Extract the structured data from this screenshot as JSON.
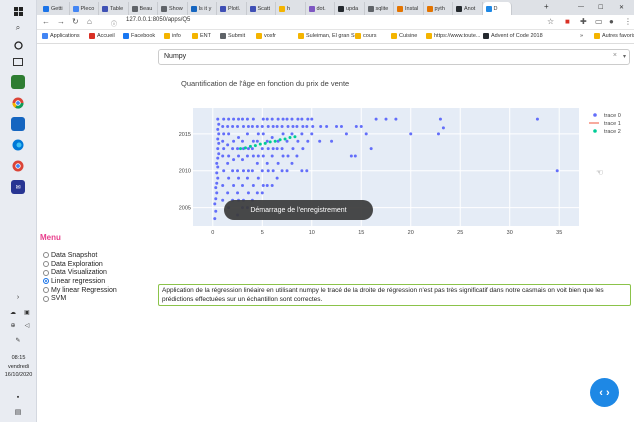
{
  "browser": {
    "tabs": [
      {
        "label": "Getti",
        "color": "#1a73e8"
      },
      {
        "label": "Pleco",
        "color": "#4285f4"
      },
      {
        "label": "Table",
        "color": "#3f51b5"
      },
      {
        "label": "Beau",
        "color": "#5f6368"
      },
      {
        "label": "Show",
        "color": "#5f6368"
      },
      {
        "label": "Is it y",
        "color": "#1565c0"
      },
      {
        "label": "Plotl.",
        "color": "#3f4fb5"
      },
      {
        "label": "Scatt",
        "color": "#3f4fb5"
      },
      {
        "label": "h",
        "color": "#f4b400"
      },
      {
        "label": "dot.",
        "color": "#7e57c2"
      },
      {
        "label": "upda",
        "color": "#24292e"
      },
      {
        "label": "sqlite",
        "color": "#5f6368"
      },
      {
        "label": "Instal",
        "color": "#e37400"
      },
      {
        "label": "pyth",
        "color": "#e37400"
      },
      {
        "label": "Anot",
        "color": "#24292e"
      },
      {
        "label": "D",
        "color": "#1e88e5"
      }
    ],
    "new_tab": "+",
    "window_controls": {
      "minimize": "—",
      "maximize": "☐",
      "close": "✕"
    },
    "url": "127.0.0.1:8050/apps/Q5",
    "bookmarks": [
      {
        "label": "Applications",
        "color": "#4285f4"
      },
      {
        "label": "Accueil",
        "color": "#d93025"
      },
      {
        "label": "Facebook",
        "color": "#1877f2"
      },
      {
        "label": "info",
        "color": "#f4b400"
      },
      {
        "label": "ENT",
        "color": "#f4b400"
      },
      {
        "label": "Submit",
        "color": "#5f6368"
      },
      {
        "label": "vosfr",
        "color": "#f4b400"
      },
      {
        "label": "Suleiman, El gran S...",
        "color": "#f4b400"
      },
      {
        "label": "cours",
        "color": "#f4b400"
      },
      {
        "label": "Cuisine",
        "color": "#f4b400"
      },
      {
        "label": "https://www.toute...",
        "color": "#f4b400"
      },
      {
        "label": "Advent of Code 2018",
        "color": "#24292e"
      },
      {
        "label": "Autres favoris",
        "color": "#f4b400"
      }
    ],
    "more_bookmarks": "»"
  },
  "taskbar": {
    "time": "08:15",
    "day": "vendredi",
    "date": "16/10/2020"
  },
  "dropdown": {
    "value": "Numpy",
    "clear": "×",
    "caret": "▾"
  },
  "chart": {
    "title": "Quantification de l'âge en fonction du prix de vente",
    "toast": "Démarrage de l'enregistrement"
  },
  "chart_data": {
    "type": "scatter",
    "title": "Quantification de l'âge en fonction du prix de vente",
    "xlabel": "",
    "ylabel": "",
    "xlim": [
      -2,
      37
    ],
    "ylim": [
      2002.5,
      2018.5
    ],
    "xticks": [
      0,
      5,
      10,
      15,
      20,
      25,
      30,
      35
    ],
    "yticks": [
      2005,
      2010,
      2015
    ],
    "grid": true,
    "legend_position": "top-right",
    "series": [
      {
        "name": "trace 0",
        "color": "#636efa",
        "mode": "markers",
        "points": [
          [
            0.2,
            2003.5
          ],
          [
            0.3,
            2004.5
          ],
          [
            0.2,
            2005.5
          ],
          [
            0.3,
            2006.2
          ],
          [
            0.4,
            2007
          ],
          [
            0.3,
            2007.7
          ],
          [
            0.4,
            2008.3
          ],
          [
            0.5,
            2009
          ],
          [
            0.4,
            2009.7
          ],
          [
            0.5,
            2010.5
          ],
          [
            0.4,
            2011
          ],
          [
            0.5,
            2011.7
          ],
          [
            0.6,
            2012.3
          ],
          [
            0.5,
            2013
          ],
          [
            0.6,
            2013.7
          ],
          [
            0.5,
            2014.3
          ],
          [
            0.6,
            2015
          ],
          [
            0.5,
            2015.6
          ],
          [
            0.6,
            2016.3
          ],
          [
            0.5,
            2017
          ],
          [
            1.0,
            2006
          ],
          [
            1.0,
            2008
          ],
          [
            1.1,
            2010
          ],
          [
            1.0,
            2012
          ],
          [
            1.1,
            2013
          ],
          [
            1.0,
            2014
          ],
          [
            1.1,
            2015
          ],
          [
            1.0,
            2016
          ],
          [
            1.1,
            2017
          ],
          [
            1.6,
            2005
          ],
          [
            1.5,
            2007
          ],
          [
            1.6,
            2009
          ],
          [
            1.5,
            2011
          ],
          [
            1.6,
            2012
          ],
          [
            1.5,
            2013.5
          ],
          [
            1.6,
            2015
          ],
          [
            1.5,
            2016
          ],
          [
            1.6,
            2017
          ],
          [
            2.0,
            2006
          ],
          [
            2.1,
            2008
          ],
          [
            2.0,
            2010
          ],
          [
            2.1,
            2011.5
          ],
          [
            2.0,
            2013
          ],
          [
            2.1,
            2014
          ],
          [
            2.0,
            2016
          ],
          [
            2.1,
            2017
          ],
          [
            2.5,
            2004
          ],
          [
            2.6,
            2006
          ],
          [
            2.5,
            2007
          ],
          [
            2.6,
            2009
          ],
          [
            2.5,
            2010
          ],
          [
            2.6,
            2012
          ],
          [
            2.5,
            2013
          ],
          [
            2.6,
            2014.5
          ],
          [
            2.5,
            2016
          ],
          [
            2.6,
            2017
          ],
          [
            3.0,
            2005
          ],
          [
            3.1,
            2006
          ],
          [
            3.0,
            2008
          ],
          [
            3.1,
            2010
          ],
          [
            3.0,
            2011.5
          ],
          [
            3.1,
            2013
          ],
          [
            3.0,
            2014
          ],
          [
            3.1,
            2016
          ],
          [
            3.0,
            2017
          ],
          [
            3.5,
            2005
          ],
          [
            3.6,
            2007
          ],
          [
            3.5,
            2009
          ],
          [
            3.6,
            2010
          ],
          [
            3.5,
            2012
          ],
          [
            3.6,
            2013
          ],
          [
            3.5,
            2015
          ],
          [
            3.6,
            2016
          ],
          [
            3.5,
            2017
          ],
          [
            4.0,
            2006
          ],
          [
            4.1,
            2008
          ],
          [
            4.0,
            2010
          ],
          [
            4.1,
            2012
          ],
          [
            4.0,
            2013
          ],
          [
            4.1,
            2014
          ],
          [
            4.0,
            2016
          ],
          [
            4.1,
            2017
          ],
          [
            4.5,
            2007
          ],
          [
            4.6,
            2009
          ],
          [
            4.5,
            2011
          ],
          [
            4.6,
            2012
          ],
          [
            4.5,
            2014
          ],
          [
            4.6,
            2015
          ],
          [
            4.5,
            2016
          ],
          [
            5.0,
            2007
          ],
          [
            5.1,
            2008
          ],
          [
            5.0,
            2010
          ],
          [
            5.1,
            2012
          ],
          [
            5.0,
            2013
          ],
          [
            5.1,
            2015
          ],
          [
            5.0,
            2016
          ],
          [
            5.1,
            2017
          ],
          [
            5.5,
            2008
          ],
          [
            5.6,
            2010
          ],
          [
            5.5,
            2011
          ],
          [
            5.6,
            2013
          ],
          [
            5.5,
            2014
          ],
          [
            5.6,
            2016
          ],
          [
            5.5,
            2017
          ],
          [
            6.0,
            2008
          ],
          [
            6.1,
            2010
          ],
          [
            6.0,
            2012
          ],
          [
            6.1,
            2013
          ],
          [
            6.0,
            2014.5
          ],
          [
            6.1,
            2016
          ],
          [
            6.0,
            2017
          ],
          [
            6.5,
            2009
          ],
          [
            6.6,
            2011
          ],
          [
            6.5,
            2013
          ],
          [
            6.6,
            2014
          ],
          [
            6.5,
            2016
          ],
          [
            6.6,
            2017
          ],
          [
            7.0,
            2010
          ],
          [
            7.1,
            2012
          ],
          [
            7.0,
            2013
          ],
          [
            7.1,
            2015
          ],
          [
            7.0,
            2016
          ],
          [
            7.1,
            2017
          ],
          [
            7.5,
            2010
          ],
          [
            7.6,
            2012
          ],
          [
            7.5,
            2014
          ],
          [
            7.6,
            2016
          ],
          [
            7.5,
            2017
          ],
          [
            8.0,
            2011
          ],
          [
            8.1,
            2013
          ],
          [
            8.0,
            2015
          ],
          [
            8.1,
            2016
          ],
          [
            8.0,
            2017
          ],
          [
            8.5,
            2012
          ],
          [
            8.6,
            2014
          ],
          [
            8.5,
            2016
          ],
          [
            8.6,
            2017
          ],
          [
            9.0,
            2010
          ],
          [
            9.1,
            2013
          ],
          [
            9.0,
            2015
          ],
          [
            9.1,
            2016
          ],
          [
            9.0,
            2017
          ],
          [
            9.5,
            2010
          ],
          [
            9.6,
            2014
          ],
          [
            9.5,
            2016
          ],
          [
            9.6,
            2017
          ],
          [
            10.0,
            2015
          ],
          [
            10.1,
            2016
          ],
          [
            10.0,
            2017
          ],
          [
            10.8,
            2014
          ],
          [
            10.9,
            2016
          ],
          [
            11.5,
            2016
          ],
          [
            12.0,
            2014
          ],
          [
            12.5,
            2016
          ],
          [
            13.0,
            2016
          ],
          [
            13.5,
            2015
          ],
          [
            14.0,
            2012
          ],
          [
            14.4,
            2012
          ],
          [
            14.5,
            2016
          ],
          [
            15.0,
            2016
          ],
          [
            15.5,
            2015
          ],
          [
            16.0,
            2013
          ],
          [
            16.5,
            2017
          ],
          [
            17.5,
            2017
          ],
          [
            18.5,
            2017
          ],
          [
            20.0,
            2015
          ],
          [
            22.8,
            2015
          ],
          [
            23.0,
            2017
          ],
          [
            23.3,
            2015.8
          ],
          [
            32.8,
            2017
          ],
          [
            34.8,
            2010
          ]
        ]
      },
      {
        "name": "trace 1",
        "color": "#ef553b",
        "mode": "lines",
        "points": []
      },
      {
        "name": "trace 2",
        "color": "#00cc96",
        "mode": "markers",
        "points": [
          [
            2.8,
            2013
          ],
          [
            3.3,
            2013.1
          ],
          [
            3.8,
            2013.3
          ],
          [
            4.3,
            2013.4
          ],
          [
            4.8,
            2013.6
          ],
          [
            5.3,
            2013.7
          ],
          [
            5.8,
            2013.9
          ],
          [
            6.3,
            2014
          ],
          [
            6.8,
            2014.2
          ],
          [
            7.3,
            2014.3
          ],
          [
            7.8,
            2014.5
          ],
          [
            8.3,
            2014.6
          ]
        ]
      }
    ]
  },
  "menu": {
    "title": "Menu",
    "items": [
      {
        "label": "Data Snapshot",
        "selected": false
      },
      {
        "label": "Data Exploration",
        "selected": false
      },
      {
        "label": "Data Visualization",
        "selected": false
      },
      {
        "label": "Linear regression",
        "selected": true
      },
      {
        "label": "My linear Regression",
        "selected": false
      },
      {
        "label": "SVM",
        "selected": false
      }
    ]
  },
  "note": "Application de la régression linéaire en utilisant numpy le tracé de la droite de régression n'est pas très significatif dans notre casmais on voit bien que les prédictions effectuées sur un échantillon sont correctes.",
  "fab": {
    "label": "‹ ›",
    "color": "#1e88e5"
  }
}
